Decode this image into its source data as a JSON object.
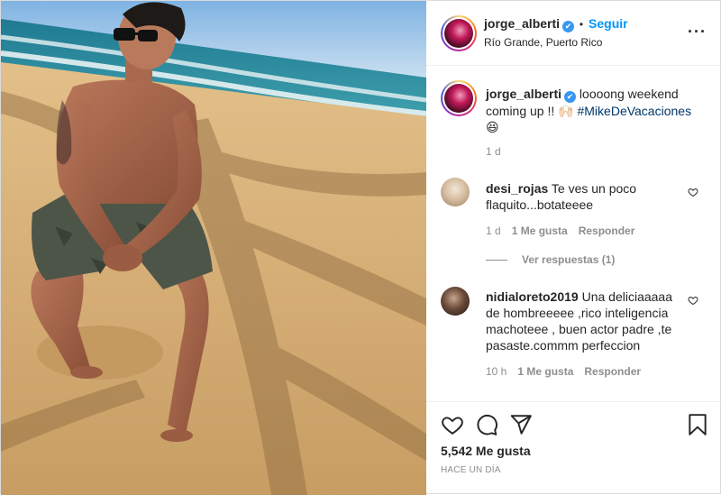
{
  "post": {
    "username": "jorge_alberti",
    "verified_glyph": "✔",
    "separator": "•",
    "follow_label": "Seguir",
    "location": "Río Grande, Puerto Rico",
    "more_label": "···",
    "caption": {
      "username": "jorge_alberti",
      "text": " loooong weekend coming up !! 🙌🏻 ",
      "hashtag": "#MikeDeVacaciones",
      "emoji_line": "😆",
      "time": "1 d"
    },
    "comments": [
      {
        "username": "desi_rojas",
        "text": " Te ves un poco flaquito...botateeee",
        "time": "1 d",
        "likes": "1 Me gusta",
        "reply": "Responder",
        "view_replies": "Ver respuestas (1)"
      },
      {
        "username": "nidialoreto2019",
        "text": " Una deliciaaaaa de hombreeeee ,rico inteligencia machoteee , buen actor padre ,te pasaste.commm perfeccion",
        "time": "10 h",
        "likes": "1 Me gusta",
        "reply": "Responder"
      }
    ],
    "likes_count": "5,542 Me gusta",
    "time_ago": "HACE UN DÍA"
  },
  "icons": {
    "like": "heart-icon",
    "comment": "comment-icon",
    "share": "paper-plane-icon",
    "save": "bookmark-icon",
    "comment_like": "heart-outline-icon",
    "more": "more-options-icon"
  },
  "colors": {
    "link_blue": "#0095f6",
    "verified_blue": "#3897f0",
    "hashtag": "#00376b",
    "muted": "#8e8e8e",
    "text": "#262626"
  }
}
